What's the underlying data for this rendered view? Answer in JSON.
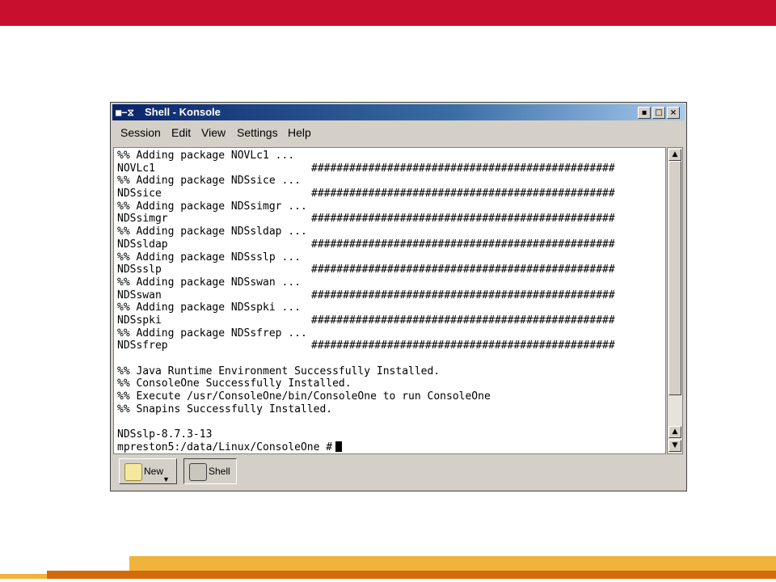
{
  "window": {
    "title": "Shell - Konsole",
    "title_icon": "■−⧖",
    "buttons": {
      "minimize": "▪",
      "maximize": "□",
      "close": "×"
    }
  },
  "menu": [
    "Session",
    "Edit",
    "View",
    "Settings",
    "Help"
  ],
  "terminal": {
    "lines": [
      {
        "text": "%% Adding package NOVLc1 ...",
        "hashes": ""
      },
      {
        "text": "NOVLc1",
        "hashes": "################################################"
      },
      {
        "text": "%% Adding package NDSsice ...",
        "hashes": ""
      },
      {
        "text": "NDSsice",
        "hashes": "################################################"
      },
      {
        "text": "%% Adding package NDSsimgr ...",
        "hashes": ""
      },
      {
        "text": "NDSsimgr",
        "hashes": "################################################"
      },
      {
        "text": "%% Adding package NDSsldap ...",
        "hashes": ""
      },
      {
        "text": "NDSsldap",
        "hashes": "################################################"
      },
      {
        "text": "%% Adding package NDSsslp ...",
        "hashes": ""
      },
      {
        "text": "NDSsslp",
        "hashes": "################################################"
      },
      {
        "text": "%% Adding package NDSswan ...",
        "hashes": ""
      },
      {
        "text": "NDSswan",
        "hashes": "################################################"
      },
      {
        "text": "%% Adding package NDSspki ...",
        "hashes": ""
      },
      {
        "text": "NDSspki",
        "hashes": "################################################"
      },
      {
        "text": "%% Adding package NDSsfrep ...",
        "hashes": ""
      },
      {
        "text": "NDSsfrep",
        "hashes": "################################################"
      },
      {
        "text": "",
        "hashes": ""
      },
      {
        "text": "%% Java Runtime Environment Successfully Installed.",
        "hashes": ""
      },
      {
        "text": "%% ConsoleOne Successfully Installed.",
        "hashes": ""
      },
      {
        "text": "%% Execute /usr/ConsoleOne/bin/ConsoleOne to run ConsoleOne",
        "hashes": ""
      },
      {
        "text": "%% Snapins Successfully Installed.",
        "hashes": ""
      },
      {
        "text": "",
        "hashes": ""
      },
      {
        "text": "NDSslp-8.7.3-13",
        "hashes": ""
      }
    ],
    "prompt": "mpreston5:/data/Linux/ConsoleOne #"
  },
  "scrollbar": {
    "up": "▲",
    "down": "▼"
  },
  "tabs": {
    "new_label": "New",
    "shell_label": "Shell",
    "dropdown": "▼"
  },
  "icons": {
    "new": "new-session-icon",
    "shell": "shell-icon"
  },
  "colors": {
    "band_red": "#c8102e",
    "band_yellow": "#f0b43c",
    "band_orange": "#d46a0a",
    "title_blue": "#0a246a"
  }
}
